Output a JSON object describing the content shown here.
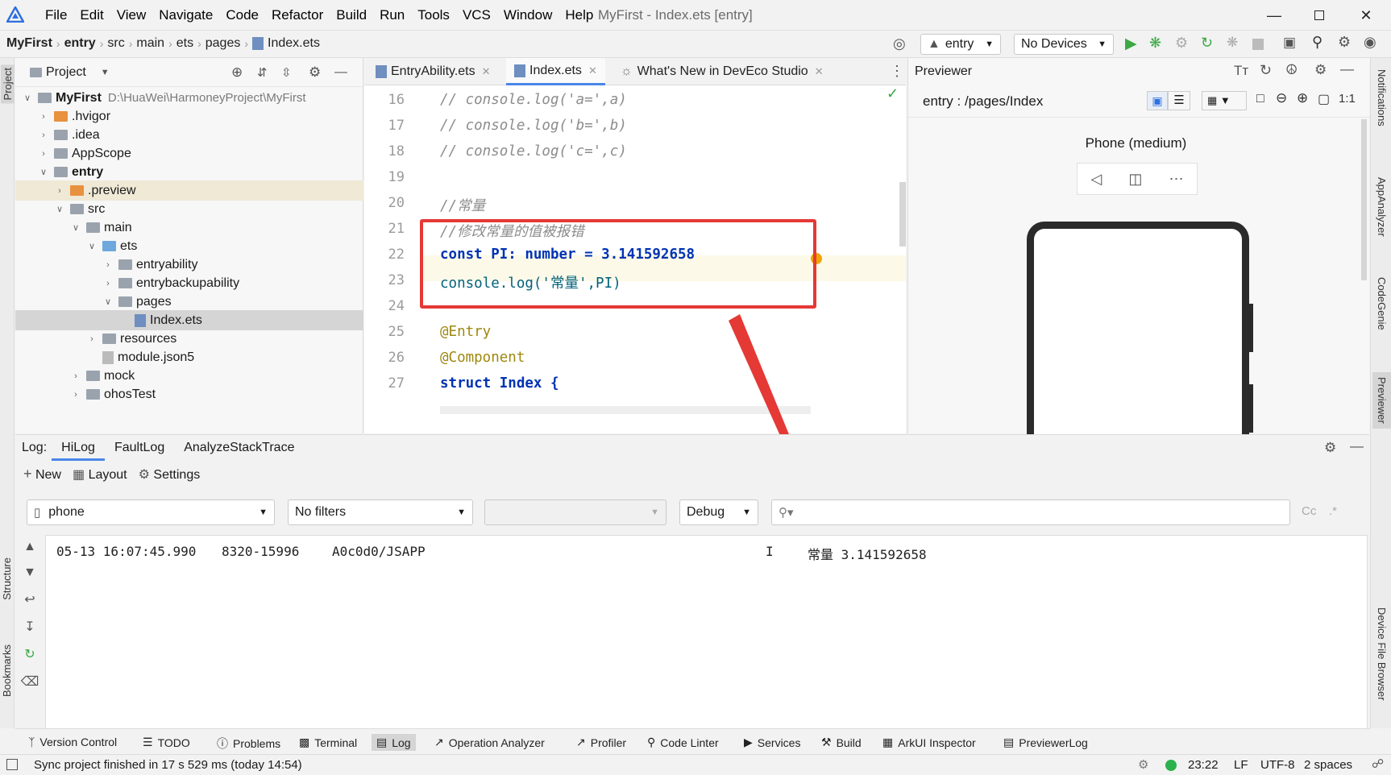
{
  "menu": [
    "File",
    "Edit",
    "View",
    "Navigate",
    "Code",
    "Refactor",
    "Build",
    "Run",
    "Tools",
    "VCS",
    "Window",
    "Help"
  ],
  "window_title": "MyFirst - Index.ets [entry]",
  "breadcrumb": [
    "MyFirst",
    "entry",
    "src",
    "main",
    "ets",
    "pages",
    "Index.ets"
  ],
  "toolbar": {
    "module": "entry",
    "device": "No Devices"
  },
  "project": {
    "header": "Project",
    "tree": [
      {
        "label": "MyFirst",
        "path": "D:\\HuaWei\\HarmoneyProject\\MyFirst",
        "type": "root"
      },
      {
        "label": ".hvigor",
        "type": "folder-orange"
      },
      {
        "label": ".idea",
        "type": "folder"
      },
      {
        "label": "AppScope",
        "type": "folder"
      },
      {
        "label": "entry",
        "type": "folder"
      },
      {
        "label": ".preview",
        "type": "folder-orange"
      },
      {
        "label": "src",
        "type": "folder"
      },
      {
        "label": "main",
        "type": "folder"
      },
      {
        "label": "ets",
        "type": "folder"
      },
      {
        "label": "entryability",
        "type": "folder"
      },
      {
        "label": "entrybackupability",
        "type": "folder"
      },
      {
        "label": "pages",
        "type": "folder"
      },
      {
        "label": "Index.ets",
        "type": "file"
      },
      {
        "label": "resources",
        "type": "folder"
      },
      {
        "label": "module.json5",
        "type": "file"
      },
      {
        "label": "mock",
        "type": "folder"
      },
      {
        "label": "ohosTest",
        "type": "folder"
      }
    ]
  },
  "tabs": [
    "EntryAbility.ets",
    "Index.ets",
    "What's New in DevEco Studio"
  ],
  "editor": {
    "line_numbers": [
      "16",
      "17",
      "18",
      "19",
      "20",
      "21",
      "22",
      "23",
      "24",
      "25",
      "26",
      "27"
    ],
    "lines": [
      "// console.log('a=',a)",
      "// console.log('b=',b)",
      "// console.log('c=',c)",
      "",
      "//常量",
      "//修改常量的值被报错",
      "const PI: number = 3.141592658",
      "console.log('常量',PI)",
      "",
      "@Entry",
      "@Component",
      "struct Index {"
    ]
  },
  "previewer": {
    "title": "Previewer",
    "path": "entry : /pages/Index",
    "device": "Phone (medium)"
  },
  "log": {
    "label": "Log:",
    "tabs": [
      "HiLog",
      "FaultLog",
      "AnalyzeStackTrace"
    ],
    "actions": [
      "New",
      "Layout",
      "Settings"
    ],
    "device_filter": "phone",
    "filter": "No filters",
    "level": "Debug",
    "entry": {
      "date": "05-13 16:07:45.990",
      "pid": "8320-15996",
      "tag": "A0c0d0/JSAPP",
      "level": "I",
      "message": "常量 3.141592658"
    }
  },
  "tool_windows": [
    "Version Control",
    "TODO",
    "Problems",
    "Terminal",
    "Log",
    "Operation Analyzer",
    "Profiler",
    "Code Linter",
    "Services",
    "Build",
    "ArkUI Inspector",
    "PreviewerLog"
  ],
  "left_strip": [
    "Project",
    "Structure",
    "Bookmarks"
  ],
  "right_strip": [
    "Notifications",
    "AppAnalyzer",
    "CodeGenie",
    "Previewer",
    "Device File Browser"
  ],
  "status": {
    "message": "Sync project finished in 17 s 529 ms (today 14:54)",
    "position": "23:22",
    "line_sep": "LF",
    "encoding": "UTF-8",
    "indent": "2 spaces"
  }
}
